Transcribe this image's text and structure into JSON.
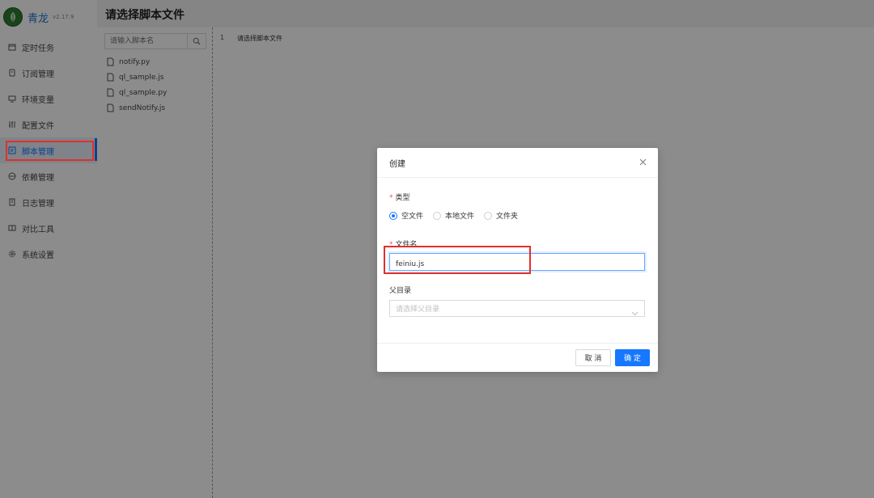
{
  "app": {
    "name": "青龙",
    "version": "v2.17.9"
  },
  "sidebar": {
    "items": [
      {
        "label": "定时任务",
        "icon": "calendar-icon"
      },
      {
        "label": "订阅管理",
        "icon": "subscription-icon"
      },
      {
        "label": "环境变量",
        "icon": "monitor-icon"
      },
      {
        "label": "配置文件",
        "icon": "sliders-icon"
      },
      {
        "label": "脚本管理",
        "icon": "script-icon",
        "active": true
      },
      {
        "label": "依赖管理",
        "icon": "dependency-icon"
      },
      {
        "label": "日志管理",
        "icon": "log-icon"
      },
      {
        "label": "对比工具",
        "icon": "diff-icon"
      },
      {
        "label": "系统设置",
        "icon": "gear-icon"
      }
    ]
  },
  "header": {
    "title": "请选择脚本文件"
  },
  "file_panel": {
    "search_placeholder": "请输入脚本名",
    "files": [
      "notify.py",
      "ql_sample.js",
      "ql_sample.py",
      "sendNotify.js"
    ]
  },
  "editor": {
    "line_number": "1",
    "line_text": "请选择脚本文件"
  },
  "modal": {
    "title": "创建",
    "type_label": "类型",
    "type_options": [
      "空文件",
      "本地文件",
      "文件夹"
    ],
    "type_selected": "空文件",
    "filename_label": "文件名",
    "filename_value": "feiniu.js",
    "parent_label": "父目录",
    "parent_placeholder": "请选择父目录",
    "cancel_label": "取 消",
    "ok_label": "确 定"
  },
  "colors": {
    "accent": "#1677ff",
    "highlight": "#e0302a",
    "logo": "#2e7d32"
  }
}
